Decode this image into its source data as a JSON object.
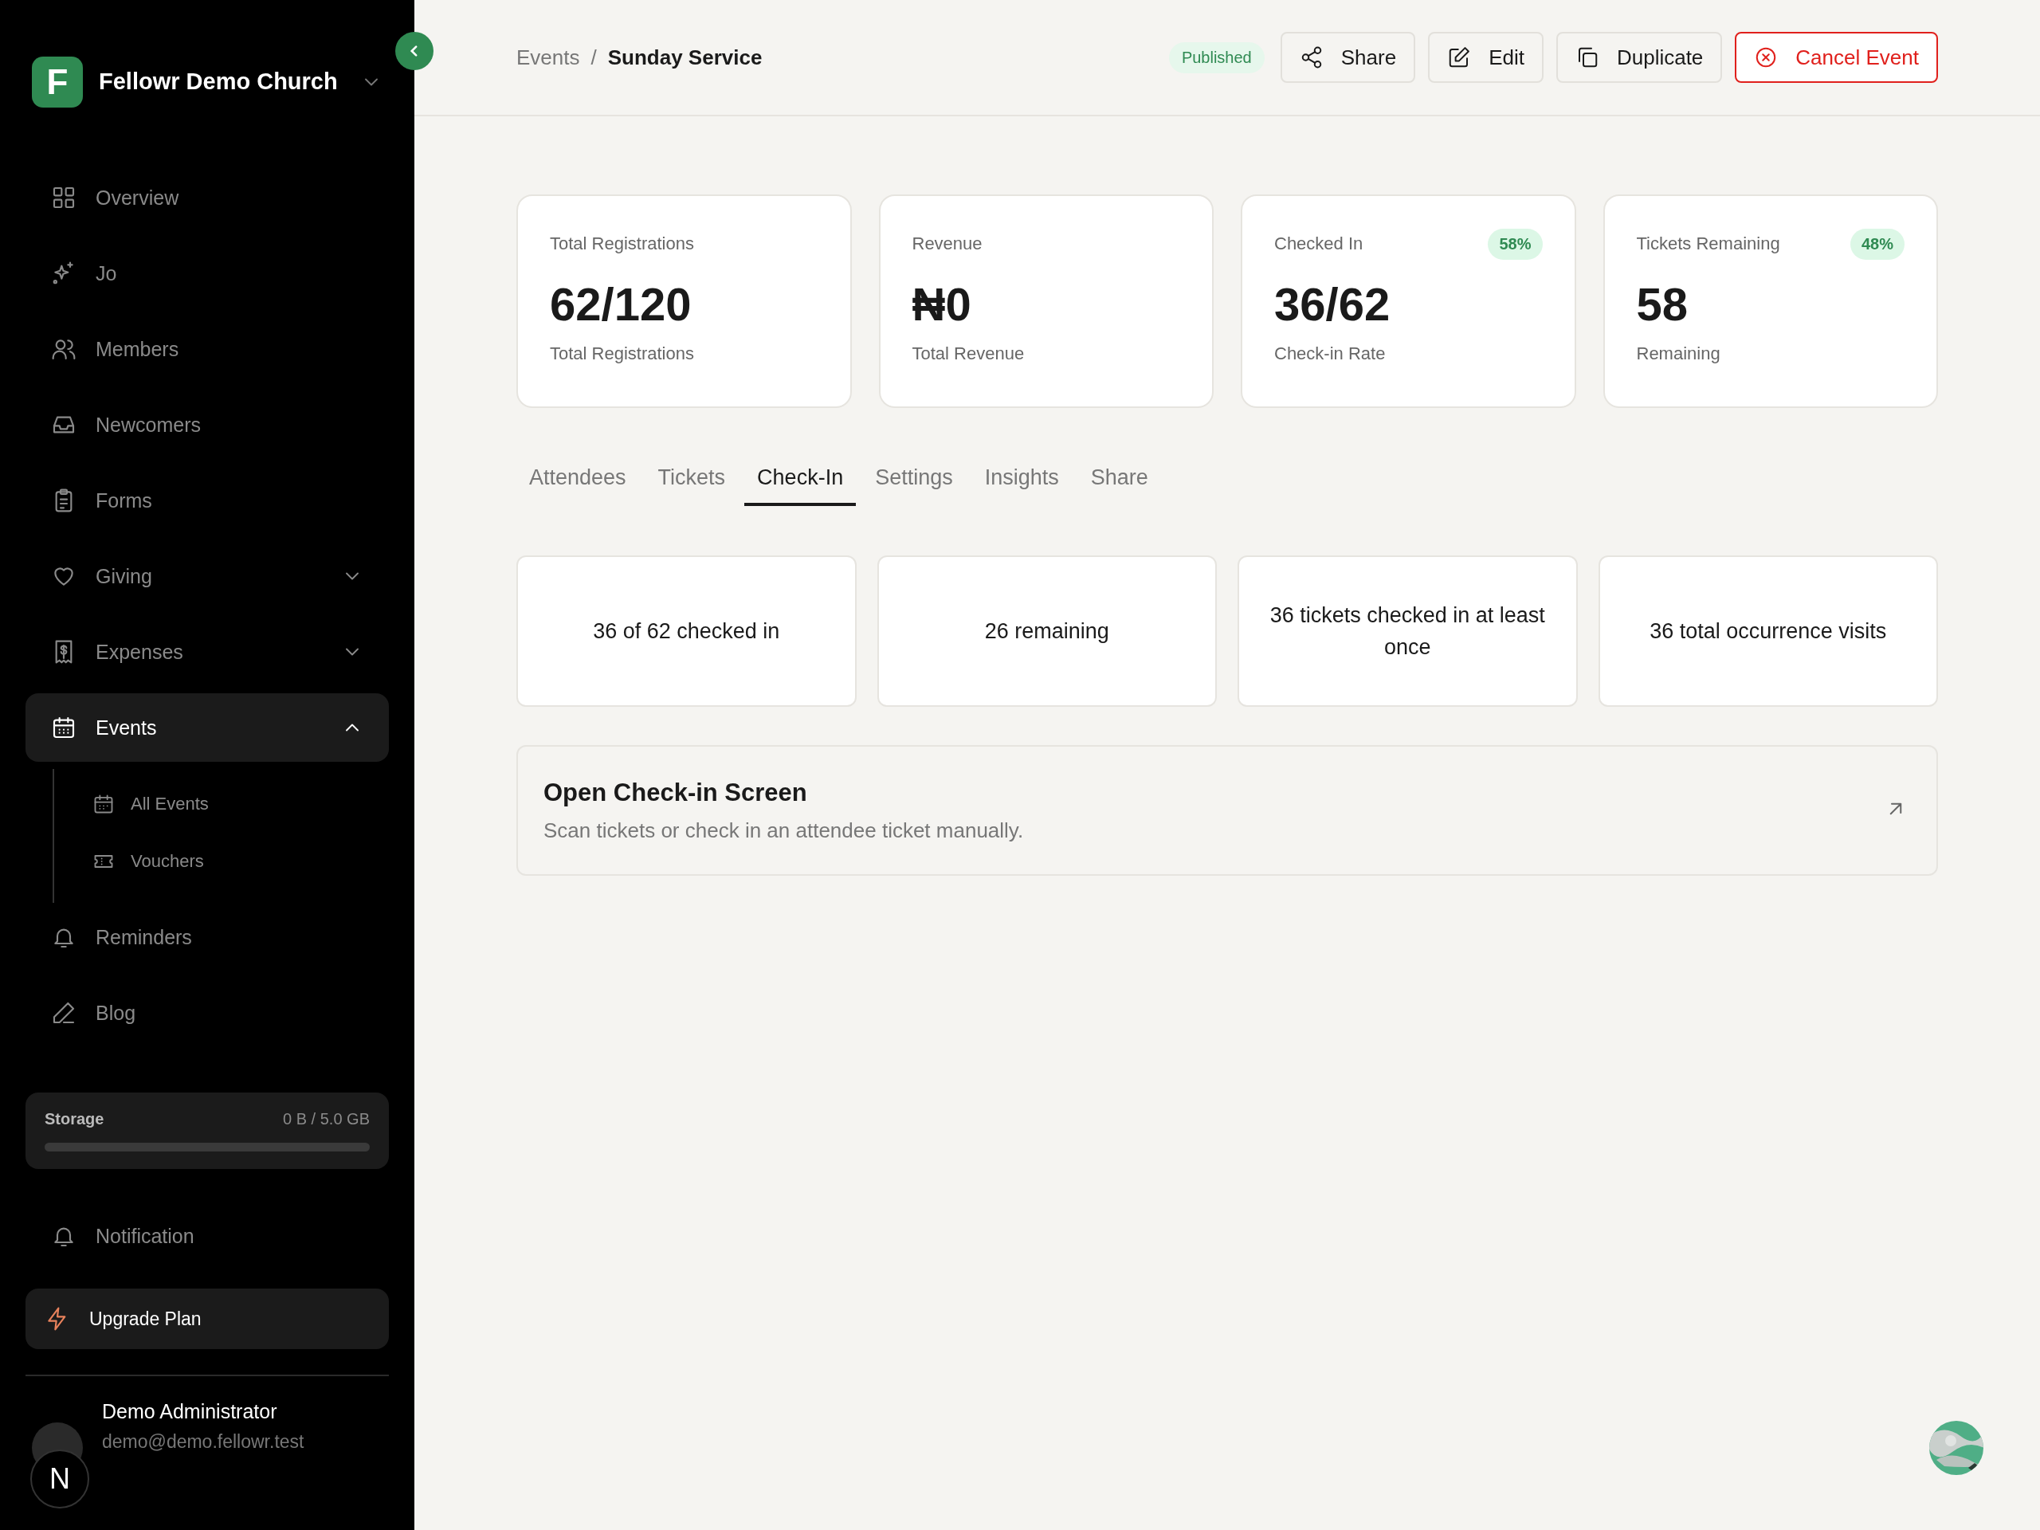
{
  "sidebar": {
    "org": {
      "logo": "F",
      "name": "Fellowr Demo Church"
    },
    "items": [
      {
        "label": "Overview",
        "selected": false
      },
      {
        "label": "Jo",
        "selected": false
      },
      {
        "label": "Members",
        "selected": false
      },
      {
        "label": "Newcomers",
        "selected": false
      },
      {
        "label": "Forms",
        "selected": false
      },
      {
        "label": "Giving",
        "selected": false,
        "expanded": false
      },
      {
        "label": "Expenses",
        "selected": false,
        "expanded": false
      },
      {
        "label": "Events",
        "selected": true,
        "expanded": true,
        "children": [
          {
            "label": "All Events",
            "selected": false
          },
          {
            "label": "Vouchers",
            "selected": false
          }
        ]
      },
      {
        "label": "Reminders",
        "selected": false
      },
      {
        "label": "Blog",
        "selected": false
      }
    ],
    "storage": {
      "label": "Storage",
      "reading": "0 B / 5.0 GB",
      "level": 0
    },
    "notification": "Notification",
    "upgrade": "Upgrade Plan",
    "user": {
      "name": "Demo Administrator",
      "email": "demo@demo.fellowr.test"
    },
    "dev_badge": "N"
  },
  "header": {
    "breadcrumb": [
      "Events",
      "/",
      "Sunday Service"
    ],
    "status": "Published",
    "buttons": [
      {
        "label": "Share",
        "kind": "share"
      },
      {
        "label": "Edit",
        "kind": "edit"
      },
      {
        "label": "Duplicate",
        "kind": "duplicate"
      },
      {
        "label": "Cancel Event",
        "kind": "danger"
      }
    ]
  },
  "stats": [
    {
      "title": "Total Registrations",
      "value": "62/120",
      "caption": "Total Registrations"
    },
    {
      "title": "Revenue",
      "value": "₦0",
      "caption": "Total Revenue"
    },
    {
      "title": "Checked In",
      "badge": "58%",
      "value": "36/62",
      "caption": "Check-in Rate"
    },
    {
      "title": "Tickets Remaining",
      "badge": "48%",
      "value": "58",
      "caption": "Remaining"
    }
  ],
  "tabs": [
    {
      "label": "Attendees",
      "selected": false
    },
    {
      "label": "Tickets",
      "selected": false
    },
    {
      "label": "Check-In",
      "selected": true
    },
    {
      "label": "Settings",
      "selected": false
    },
    {
      "label": "Insights",
      "selected": false
    },
    {
      "label": "Share",
      "selected": false
    }
  ],
  "checkin_cards": [
    "36 of 62 checked in",
    "26 remaining",
    "36 tickets checked in at least once",
    "36 total occurrence visits"
  ],
  "open_screen": {
    "title": "Open Check-in Screen",
    "description": "Scan tickets or check in an attendee ticket manually."
  }
}
